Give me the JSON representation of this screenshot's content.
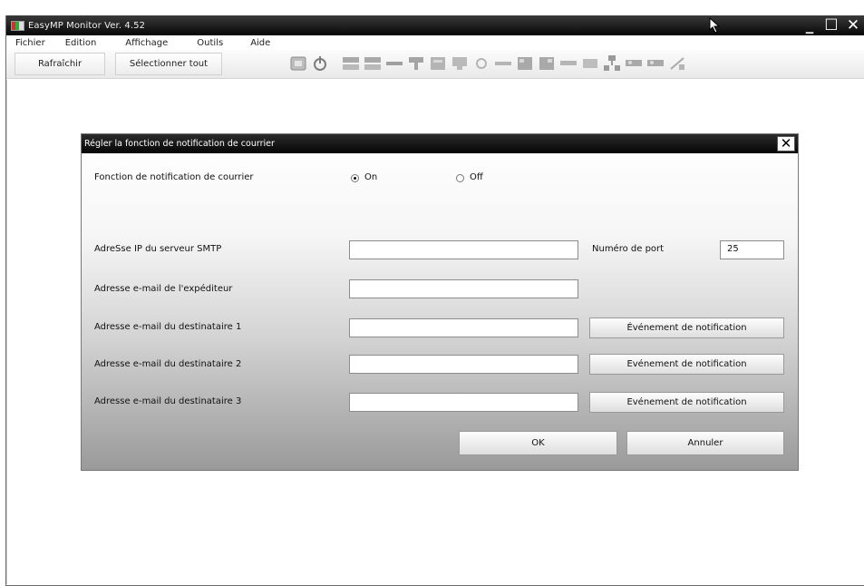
{
  "window": {
    "title": "EasyMP Monitor Ver. 4.52",
    "buttons": {
      "minimize": "_",
      "maximize": "☐",
      "close": "✕"
    }
  },
  "menu": [
    "Fichier",
    "Edition",
    "Affichage",
    "Outils",
    "Aide"
  ],
  "toolbar": {
    "refresh_label": "Rafraîchir",
    "select_all_label": "Sélectionner tout",
    "icons": [
      "shutter-icon",
      "power-icon",
      "projector-a-icon",
      "projector-b-icon",
      "line-icon",
      "monitor-a-icon",
      "monitor-b-icon",
      "monitor-c-icon",
      "circle-icon",
      "bar-icon",
      "grid-a-icon",
      "grid-b-icon",
      "bar-b-icon",
      "screen-icon",
      "network-icon",
      "projector-c-icon",
      "projector-d-icon",
      "wireless-icon"
    ]
  },
  "dialog": {
    "title": "Régler la fonction de notification de courrier",
    "close": "✕",
    "notify_label": "Fonction de notification de courrier",
    "on_label": "On",
    "off_label": "Off",
    "selected": "On",
    "smtp_label": "AdreSse IP du serveur SMTP",
    "smtp_value": "",
    "port_label": "Numéro de port",
    "port_value": "25",
    "sender_label": "Adresse e-mail de l'expéditeur",
    "sender_value": "",
    "recipients": [
      {
        "label": "Adresse e-mail du destinataire 1",
        "value": "",
        "button": "Événement de notification"
      },
      {
        "label": "Adresse e-mail du destinataire 2",
        "value": "",
        "button": "Evénement de notification"
      },
      {
        "label": "Adresse e-mail du destinataire 3",
        "value": "",
        "button": "Evénement de notification"
      }
    ],
    "ok_label": "OK",
    "cancel_label": "Annuler"
  },
  "colors": {
    "titlebar": "#111111",
    "dialog_gradient_end": "#9a9a9a"
  }
}
